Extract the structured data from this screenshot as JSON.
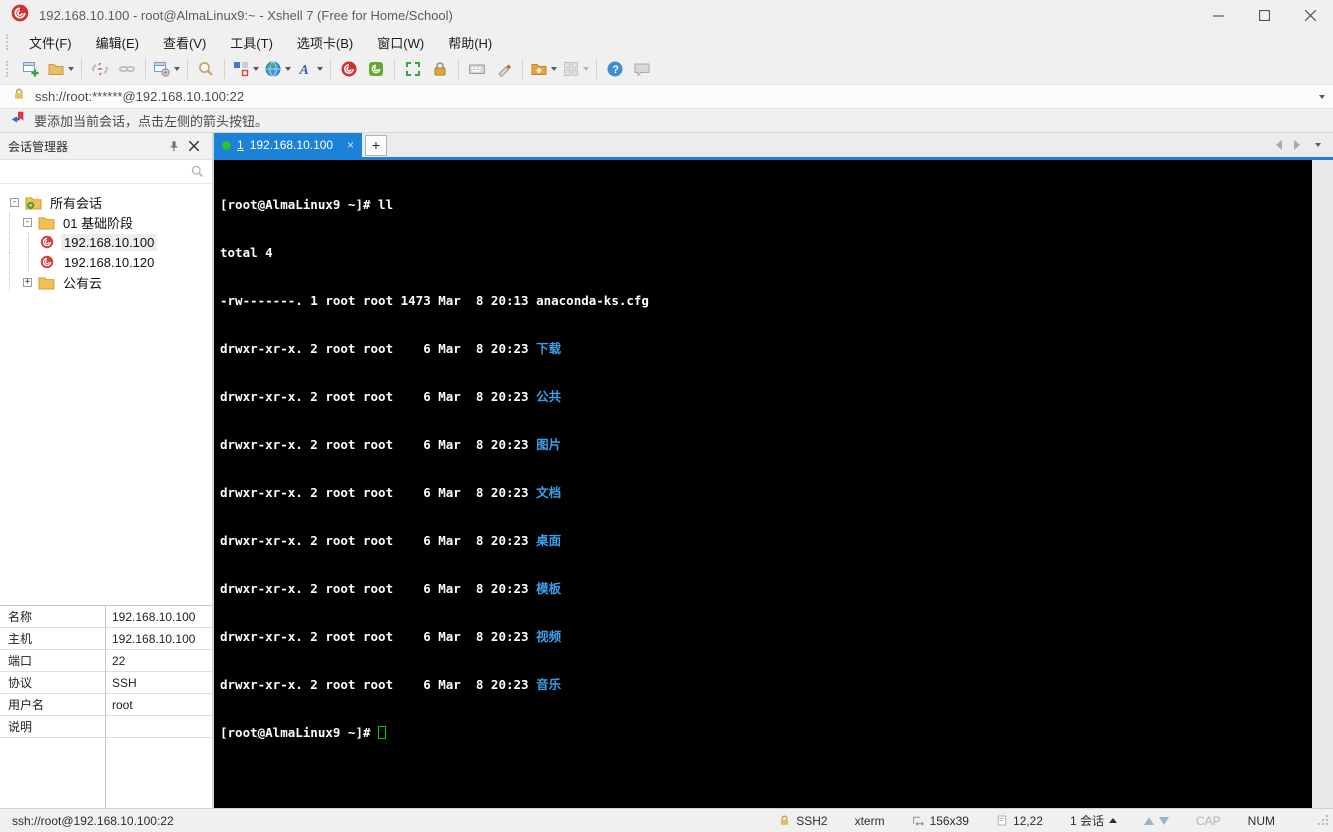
{
  "title_bar": {
    "title": "192.168.10.100 - root@AlmaLinux9:~ - Xshell 7 (Free for Home/School)"
  },
  "menu_bar": {
    "items": [
      {
        "label": "文件(F)"
      },
      {
        "label": "编辑(E)"
      },
      {
        "label": "查看(V)"
      },
      {
        "label": "工具(T)"
      },
      {
        "label": "选项卡(B)"
      },
      {
        "label": "窗口(W)"
      },
      {
        "label": "帮助(H)"
      }
    ]
  },
  "toolbar": {
    "icons": [
      "new-session-icon",
      "open-folder-icon",
      "disconnect-icon",
      "reconnect-icon",
      "session-properties-icon",
      "find-icon",
      "layout-icon",
      "web-icon",
      "font-icon",
      "xshell-icon",
      "xftp-icon",
      "fullscreen-icon",
      "lock-icon",
      "virtual-keyboard-icon",
      "highlight-icon",
      "new-file-icon",
      "tile-windows-icon",
      "help-icon",
      "feedback-icon"
    ]
  },
  "address_bar": {
    "url": "ssh://root:******@192.168.10.100:22"
  },
  "info_bar": {
    "message": "要添加当前会话，点击左侧的箭头按钮。"
  },
  "session_manager": {
    "title": "会话管理器",
    "tree": [
      {
        "label": "所有会话",
        "toggle": "-"
      },
      {
        "label": "01 基础阶段",
        "toggle": "-"
      },
      {
        "label": "192.168.10.100"
      },
      {
        "label": "192.168.10.120"
      },
      {
        "label": "公有云",
        "toggle": "+"
      }
    ],
    "properties": {
      "rows": [
        {
          "label": "名称",
          "value": "192.168.10.100"
        },
        {
          "label": "主机",
          "value": "192.168.10.100"
        },
        {
          "label": "端口",
          "value": "22"
        },
        {
          "label": "协议",
          "value": "SSH"
        },
        {
          "label": "用户名",
          "value": "root"
        },
        {
          "label": "说明",
          "value": ""
        }
      ]
    }
  },
  "tab_bar": {
    "active_tab": {
      "index": "1",
      "label": "192.168.10.100",
      "close": "×"
    },
    "new_tab": "+"
  },
  "terminal": {
    "lines": [
      {
        "text": "[root@AlmaLinux9 ~]# ll"
      },
      {
        "text": "total 4"
      },
      {
        "text": "-rw-------. 1 root root 1473 Mar  8 20:13 anaconda-ks.cfg"
      },
      {
        "text": "drwxr-xr-x. 2 root root    6 Mar  8 20:23 ",
        "dir": "下载"
      },
      {
        "text": "drwxr-xr-x. 2 root root    6 Mar  8 20:23 ",
        "dir": "公共"
      },
      {
        "text": "drwxr-xr-x. 2 root root    6 Mar  8 20:23 ",
        "dir": "图片"
      },
      {
        "text": "drwxr-xr-x. 2 root root    6 Mar  8 20:23 ",
        "dir": "文档"
      },
      {
        "text": "drwxr-xr-x. 2 root root    6 Mar  8 20:23 ",
        "dir": "桌面"
      },
      {
        "text": "drwxr-xr-x. 2 root root    6 Mar  8 20:23 ",
        "dir": "模板"
      },
      {
        "text": "drwxr-xr-x. 2 root root    6 Mar  8 20:23 ",
        "dir": "视频"
      },
      {
        "text": "drwxr-xr-x. 2 root root    6 Mar  8 20:23 ",
        "dir": "音乐"
      },
      {
        "text": "[root@AlmaLinux9 ~]# "
      }
    ]
  },
  "status_bar": {
    "left": "ssh://root@192.168.10.100:22",
    "encryption": "SSH2",
    "terminal_type": "xterm",
    "screen_size": "156x39",
    "cursor_position": "12,22",
    "session_count": "1 会话",
    "cap": "CAP",
    "num": "NUM"
  }
}
